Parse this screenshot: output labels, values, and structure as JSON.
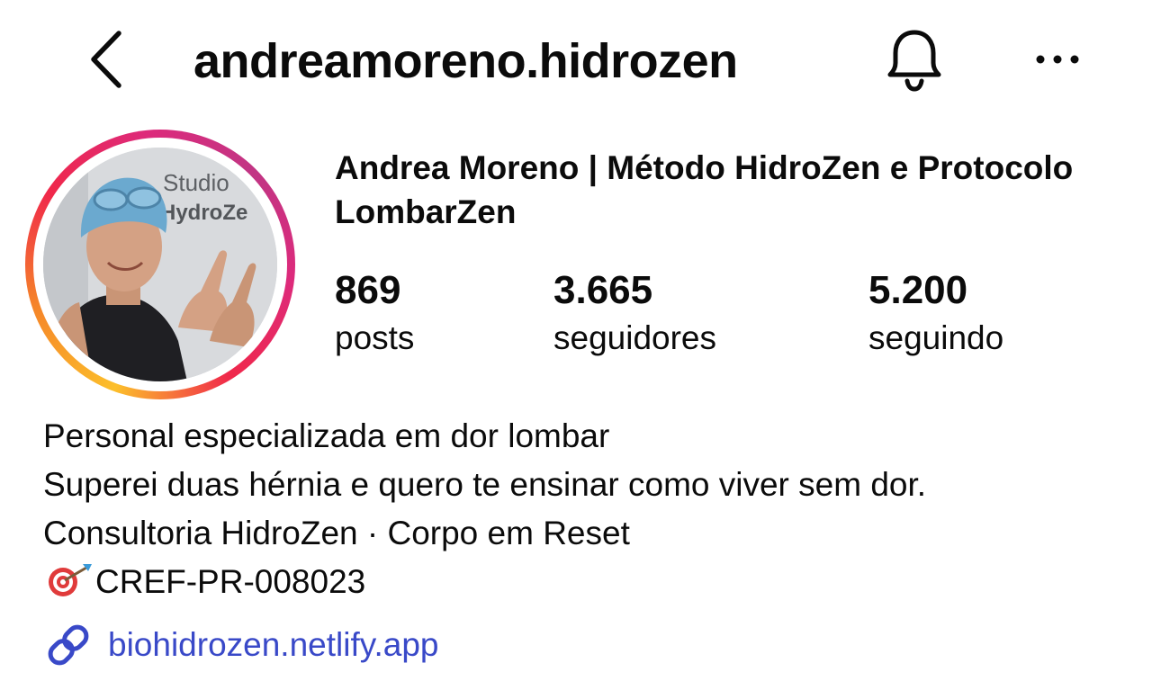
{
  "header": {
    "username": "andreamoreno.hidrozen",
    "back_icon": "chevron-left-icon",
    "bell_icon": "bell-icon",
    "more_icon": "more-horizontal-icon"
  },
  "avatar": {
    "photo_text_line1": "Studio",
    "photo_text_line2": "HydroZe"
  },
  "profile": {
    "display_name": "Andrea Moreno | Método HidroZen e Protocolo LombarZen",
    "stats": [
      {
        "value": "869",
        "label": "posts"
      },
      {
        "value": "3.665",
        "label": "seguidores"
      },
      {
        "value": "5.200",
        "label": "seguindo"
      }
    ]
  },
  "bio": {
    "lines": [
      "Personal especializada em dor lombar",
      "Superei duas hérnia e quero te ensinar como viver sem dor.",
      "Consultoria HidroZen · Corpo em Reset",
      "CREF-PR-008023"
    ],
    "line4_icon": "direct-hit-target-icon",
    "link_icon": "link-icon",
    "link_text": "biohidrozen.netlify.app"
  },
  "colors": {
    "link": "#3949c8",
    "text": "#0b0b0b",
    "ring_gradient": [
      "#fcbf2b",
      "#f58529",
      "#dd2a7b",
      "#c13584"
    ]
  }
}
